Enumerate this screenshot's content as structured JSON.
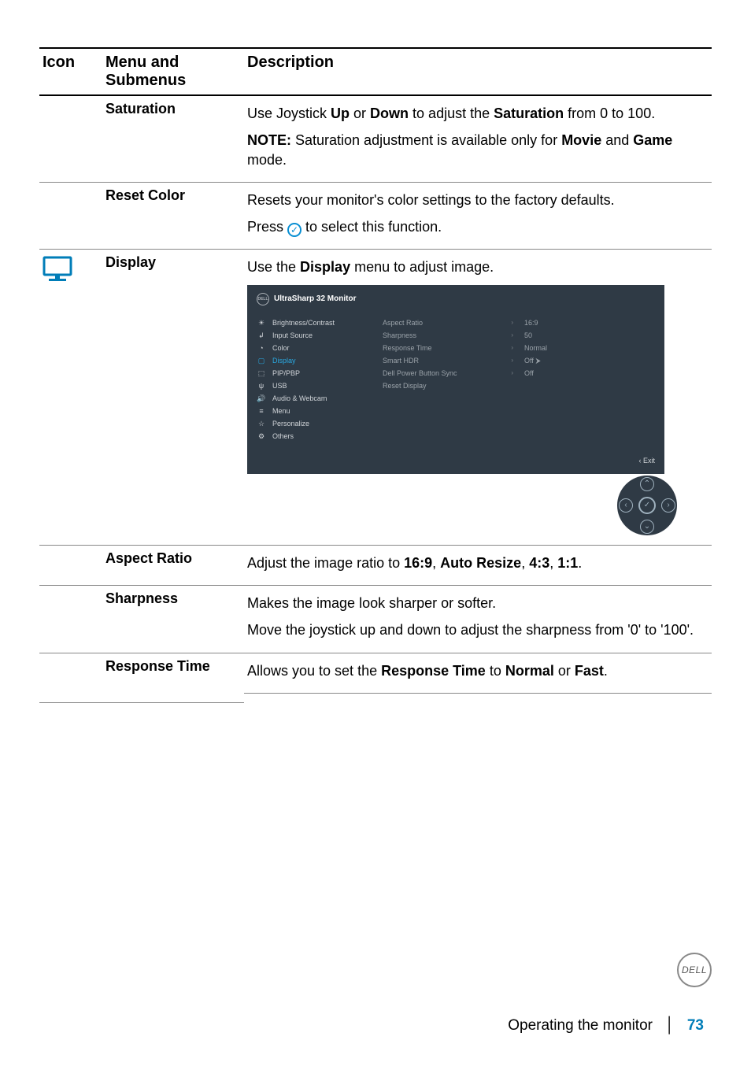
{
  "columns": {
    "icon": "Icon",
    "menu": "Menu and Submenus",
    "desc": "Description"
  },
  "rows": {
    "saturation": {
      "name": "Saturation",
      "p1a": "Use Joystick ",
      "p1b": "Up",
      "p1c": " or ",
      "p1d": "Down",
      "p1e": " to adjust the ",
      "p1f": "Saturation",
      "p1g": " from 0 to 100.",
      "p2a": "NOTE:",
      "p2b": " Saturation adjustment is available only for ",
      "p2c": "Movie",
      "p2d": " and ",
      "p2e": "Game",
      "p2f": " mode."
    },
    "resetcolor": {
      "name": "Reset Color",
      "p1": "Resets your monitor's color settings to the factory defaults.",
      "p2a": "Press ",
      "p2b": " to select this function."
    },
    "display": {
      "name": "Display",
      "p1a": "Use the ",
      "p1b": "Display",
      "p1c": " menu to adjust image."
    },
    "aspect": {
      "name": "Aspect Ratio",
      "p1a": "Adjust the image ratio to ",
      "p1b": "16:9",
      "p1c": ", ",
      "p1d": "Auto Resize",
      "p1e": ", ",
      "p1f": "4:3",
      "p1g": ", ",
      "p1h": "1:1",
      "p1i": "."
    },
    "sharpness": {
      "name": "Sharpness",
      "p1": "Makes the image look sharper or softer.",
      "p2": "Move the joystick up and down to adjust the sharpness from '0' to '100'."
    },
    "responsetime": {
      "name": "Response Time",
      "p1a": "Allows you to set the ",
      "p1b": "Response Time",
      "p1c": " to ",
      "p1d": "Normal",
      "p1e": " or ",
      "p1f": "Fast",
      "p1g": "."
    }
  },
  "osd": {
    "title": "UltraSharp 32 Monitor",
    "left": {
      "brightness": "Brightness/Contrast",
      "input": "Input Source",
      "color": "Color",
      "display": "Display",
      "pip": "PIP/PBP",
      "usb": "USB",
      "audio": "Audio & Webcam",
      "menu": "Menu",
      "personalize": "Personalize",
      "others": "Others"
    },
    "mid": {
      "aspect": "Aspect Ratio",
      "sharpness": "Sharpness",
      "response": "Response Time",
      "smarthdr": "Smart HDR",
      "dellpower": "Dell Power Button Sync",
      "resetdisp": "Reset Display"
    },
    "right": {
      "aspect": "16:9",
      "sharpness": "50",
      "response": "Normal",
      "smarthdr": "Off ⮞",
      "dellpower": "Off"
    },
    "exit": "‹  Exit"
  },
  "footer": {
    "section": "Operating the monitor",
    "page": "73",
    "brand": "DELL"
  },
  "glyphs": {
    "check": "✓",
    "chev": "›",
    "sun": "☀",
    "input": "↲",
    "palette": "◔",
    "display": "▢",
    "pip": "⬚",
    "usb": "ψ",
    "audio": "🔊",
    "menu": "≡",
    "star": "☆",
    "others": "⚙",
    "up": "⌃",
    "down": "⌄",
    "left": "‹",
    "right": "›"
  }
}
